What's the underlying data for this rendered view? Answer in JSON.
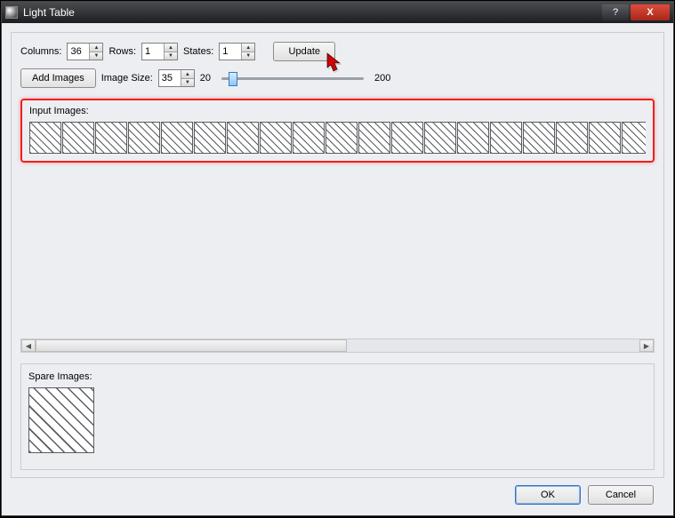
{
  "window": {
    "title": "Light Table"
  },
  "controls": {
    "columns_label": "Columns:",
    "columns_value": "36",
    "rows_label": "Rows:",
    "rows_value": "1",
    "states_label": "States:",
    "states_value": "1",
    "update_label": "Update",
    "add_images_label": "Add Images",
    "image_size_label": "Image Size:",
    "image_size_value": "35",
    "slider_min": "20",
    "slider_max": "200"
  },
  "sections": {
    "input_label": "Input Images:",
    "spare_label": "Spare Images:"
  },
  "footer": {
    "ok": "OK",
    "cancel": "Cancel"
  },
  "input_cells": 20,
  "spare_cells": 1,
  "icons": {
    "help": "?",
    "close": "X",
    "up": "▲",
    "down": "▼",
    "left": "◀",
    "right": "▶"
  }
}
